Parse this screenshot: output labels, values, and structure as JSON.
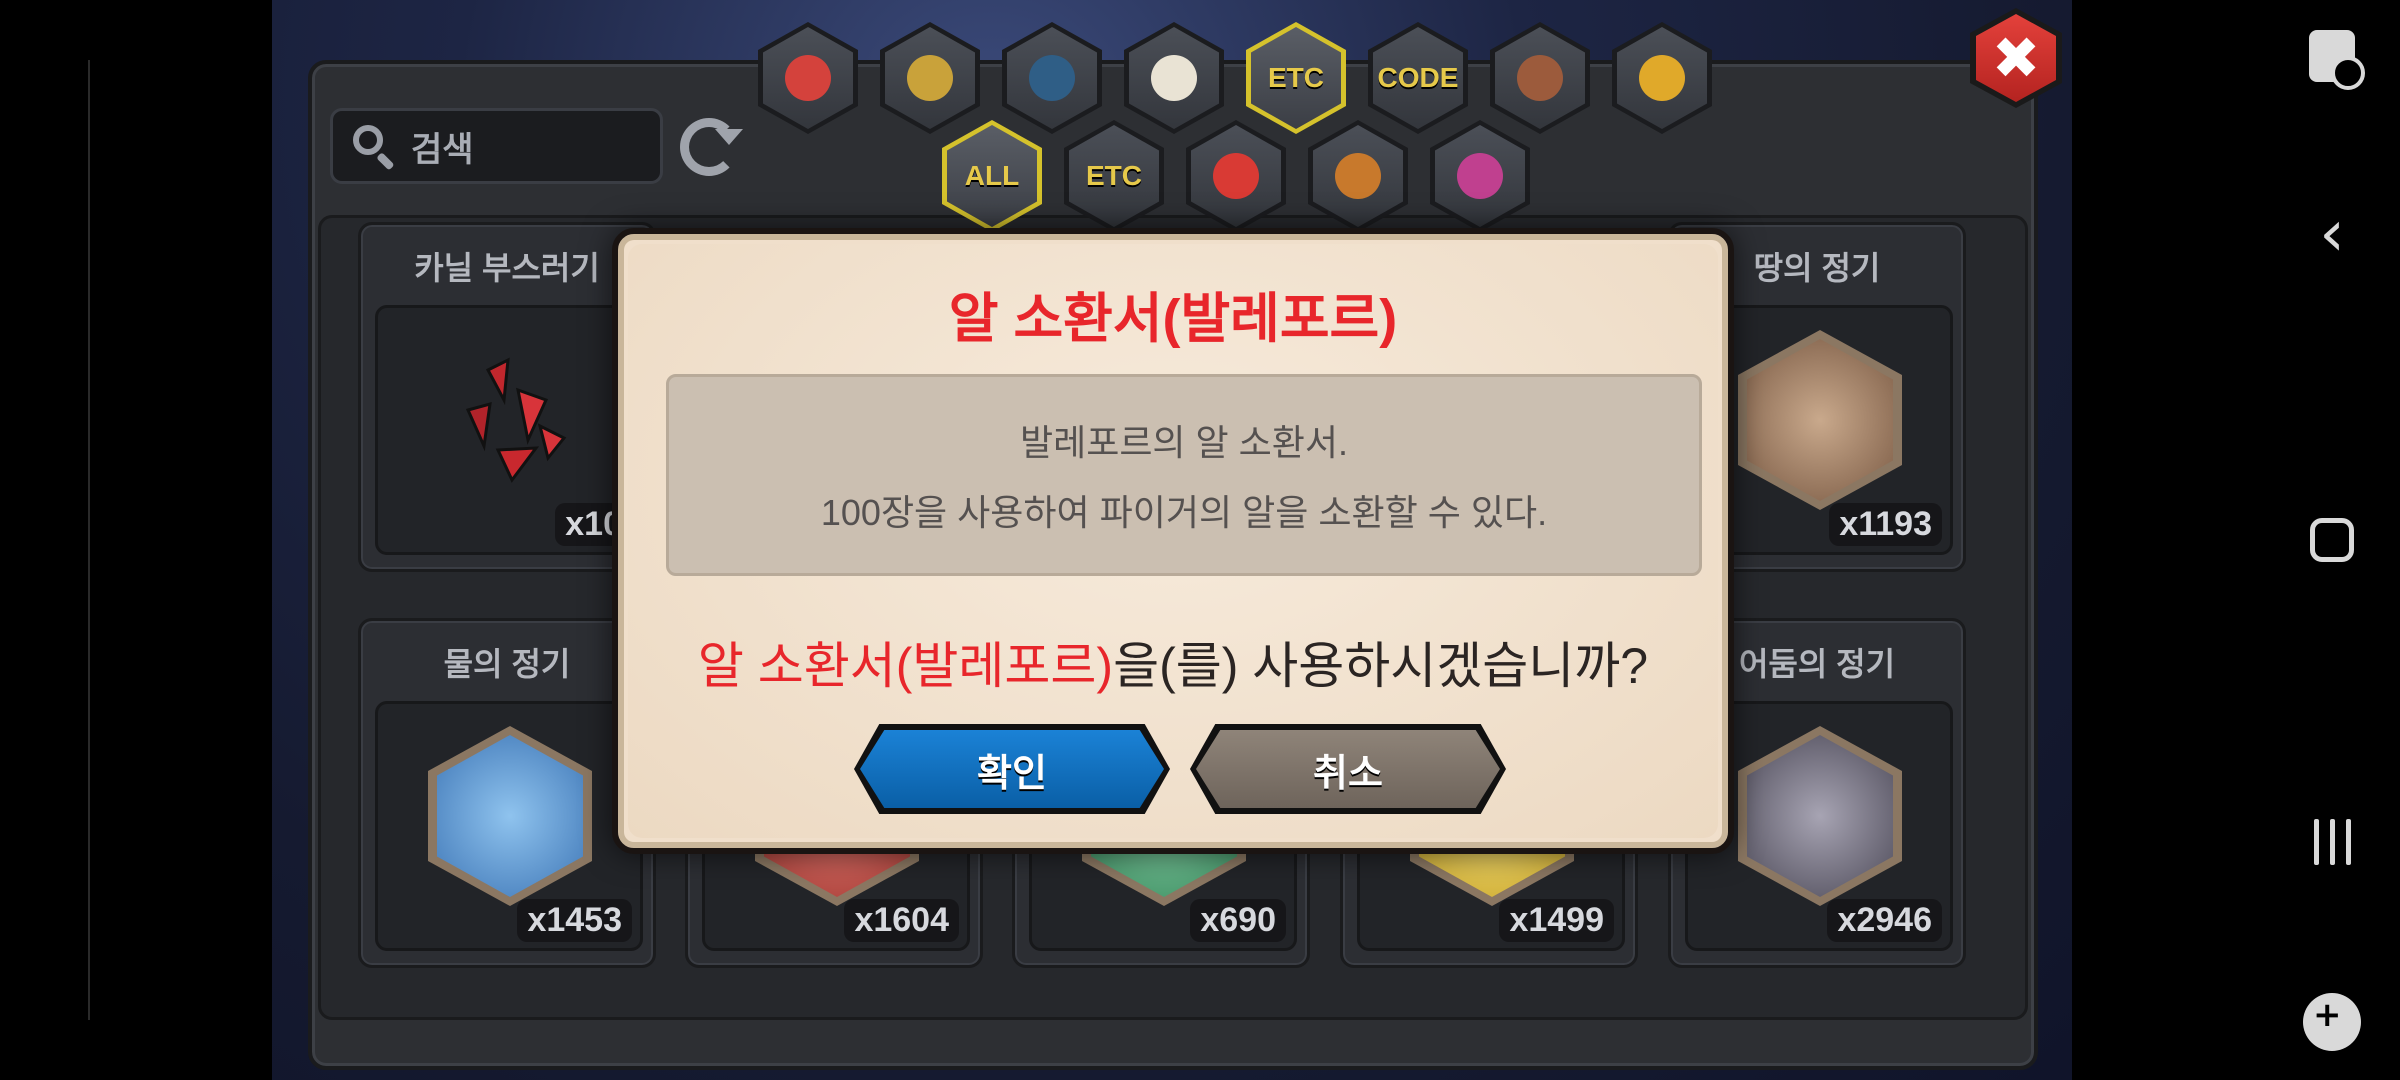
{
  "search": {
    "label": "검색"
  },
  "category_tabs": {
    "row1": [
      {
        "id": "food",
        "label": "",
        "color": "#d4423c"
      },
      {
        "id": "gold",
        "label": "",
        "color": "#c9a23a"
      },
      {
        "id": "scale",
        "label": "",
        "color": "#2f5e86"
      },
      {
        "id": "egg",
        "label": "",
        "color": "#e9e3d4"
      },
      {
        "id": "etc",
        "label": "ETC",
        "active": true
      },
      {
        "id": "code",
        "label": "CODE"
      },
      {
        "id": "dragon",
        "label": "",
        "color": "#9c5b3c"
      },
      {
        "id": "mask",
        "label": "",
        "color": "#e0a92a"
      }
    ],
    "row2": [
      {
        "id": "all",
        "label": "ALL",
        "active": true
      },
      {
        "id": "etc2",
        "label": "ETC"
      },
      {
        "id": "capsule",
        "label": "",
        "color": "#d93a34"
      },
      {
        "id": "medal",
        "label": "",
        "color": "#c8792c"
      },
      {
        "id": "gift",
        "label": "",
        "color": "#c0408f"
      }
    ]
  },
  "items": [
    {
      "name": "카닐 부스러기",
      "count": "x10",
      "color": "#c1272d"
    },
    {
      "name": "땅의 정기",
      "count": "x1193",
      "color": "#7a5a44"
    },
    {
      "name": "물의 정기",
      "count": "x1453",
      "color": "#3e76b6"
    },
    {
      "name": "",
      "count": "x1604",
      "color": "#a43a34"
    },
    {
      "name": "",
      "count": "x690",
      "color": "#3a8a5e"
    },
    {
      "name": "",
      "count": "x1499",
      "color": "#c9a62a"
    },
    {
      "name": "어둠의 정기",
      "count": "x2946",
      "color": "#4d4a58"
    }
  ],
  "modal": {
    "title": "알 소환서(발레포르)",
    "desc_line1": "발레포르의 알 소환서.",
    "desc_line2": "100장을 사용하여 파이거의 알을 소환할 수 있다.",
    "question_item": "알 소환서(발레포르)",
    "question_rest": "을(를) 사용하시겠습니까?",
    "confirm_label": "확인",
    "cancel_label": "취소"
  },
  "close_label": "✖",
  "nav": {
    "back": "‹"
  }
}
